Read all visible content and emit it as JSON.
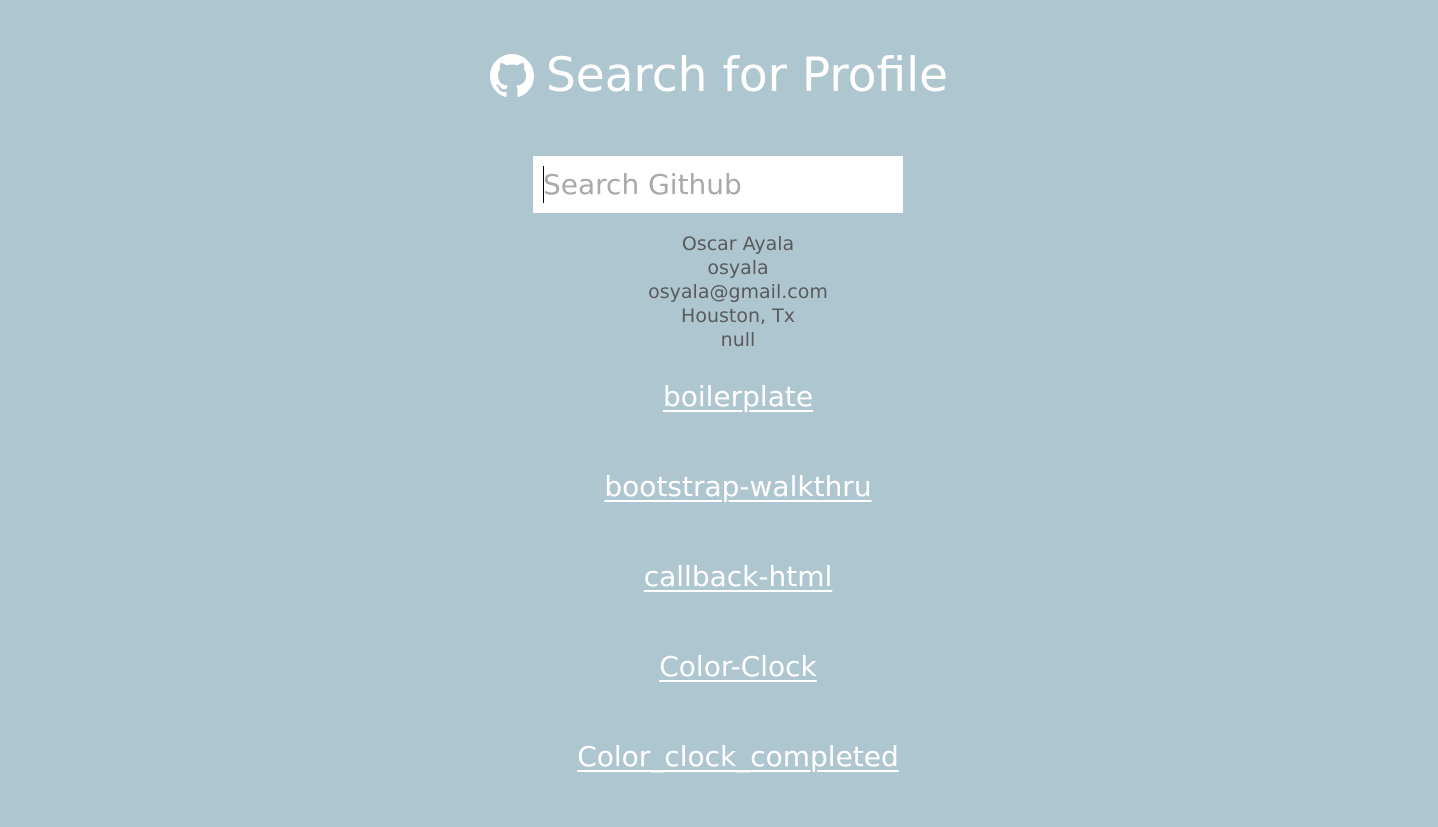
{
  "header": {
    "icon": "github-icon",
    "title": "Search for Profile"
  },
  "search": {
    "value": "",
    "placeholder": "Search Github"
  },
  "profile": {
    "name": "Oscar Ayala",
    "username": "osyala",
    "email": "osyala@gmail.com",
    "location": "Houston, Tx",
    "extra": "null"
  },
  "repos": [
    {
      "name": "boilerplate"
    },
    {
      "name": "bootstrap-walkthru"
    },
    {
      "name": "callback-html"
    },
    {
      "name": "Color-Clock"
    },
    {
      "name": "Color_clock_completed"
    }
  ],
  "colors": {
    "background": "#aec6d0",
    "heading": "#ffffff",
    "profile_text": "#5a5a5a",
    "input_background": "#ffffff",
    "link": "#ffffff"
  }
}
